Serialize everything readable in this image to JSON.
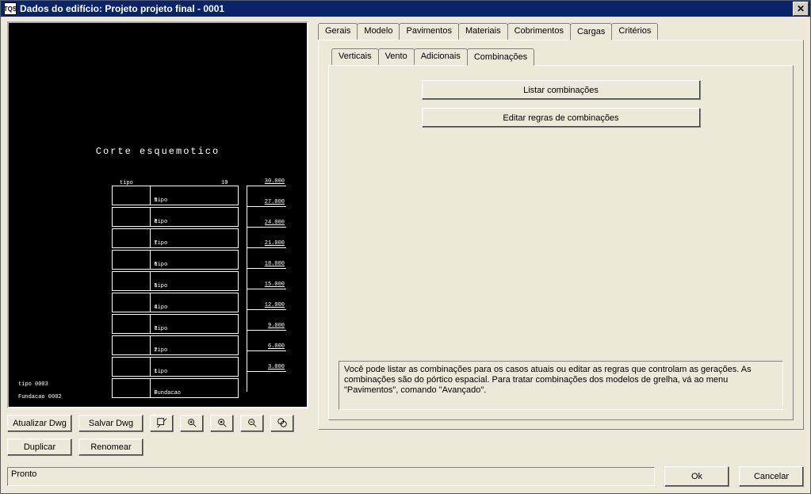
{
  "window": {
    "icon_text": "TQS",
    "title": "Dados do edifício: Projeto projeto final - 0001"
  },
  "preview": {
    "title": "Corte esquemotico",
    "header_left": "tipo",
    "header_right": "10",
    "rows": [
      {
        "label": "tipo",
        "n": "9"
      },
      {
        "label": "tipo",
        "n": "8"
      },
      {
        "label": "tipo",
        "n": "7"
      },
      {
        "label": "tipo",
        "n": "6"
      },
      {
        "label": "tipo",
        "n": "5"
      },
      {
        "label": "tipo",
        "n": "4"
      },
      {
        "label": "tipo",
        "n": "3"
      },
      {
        "label": "tipo",
        "n": "2"
      },
      {
        "label": "tipo",
        "n": "1"
      },
      {
        "label": "Fundacao",
        "n": "0"
      }
    ],
    "ticks": [
      "30.000",
      "27.000",
      "24.000",
      "21.000",
      "18.000",
      "15.000",
      "12.000",
      "9.000",
      "6.000",
      "3.000"
    ],
    "footer1": "tipo   0003",
    "footer2": "Fundacao 0002"
  },
  "left_buttons": {
    "update": "Atualizar Dwg",
    "save": "Salvar Dwg",
    "duplicate": "Duplicar",
    "rename": "Renomear"
  },
  "tabs_main": {
    "items": [
      "Gerais",
      "Modelo",
      "Pavimentos",
      "Materiais",
      "Cobrimentos",
      "Cargas",
      "Critérios"
    ],
    "active": 5
  },
  "tabs_inner": {
    "items": [
      "Verticais",
      "Vento",
      "Adicionais",
      "Combinações"
    ],
    "active": 3
  },
  "combo_panel": {
    "list_btn": "Listar combinações",
    "edit_btn": "Editar regras de combinações",
    "desc": "Você pode listar as combinações para os casos atuais ou editar as regras que controlam as gerações. As combinações são do pórtico espacial. Para tratar combinações dos modelos de grelha, vá ao menu \"Pavimentos\", comando \"Avançado\"."
  },
  "status": "Pronto",
  "footer_buttons": {
    "ok": "Ok",
    "cancel": "Cancelar"
  }
}
